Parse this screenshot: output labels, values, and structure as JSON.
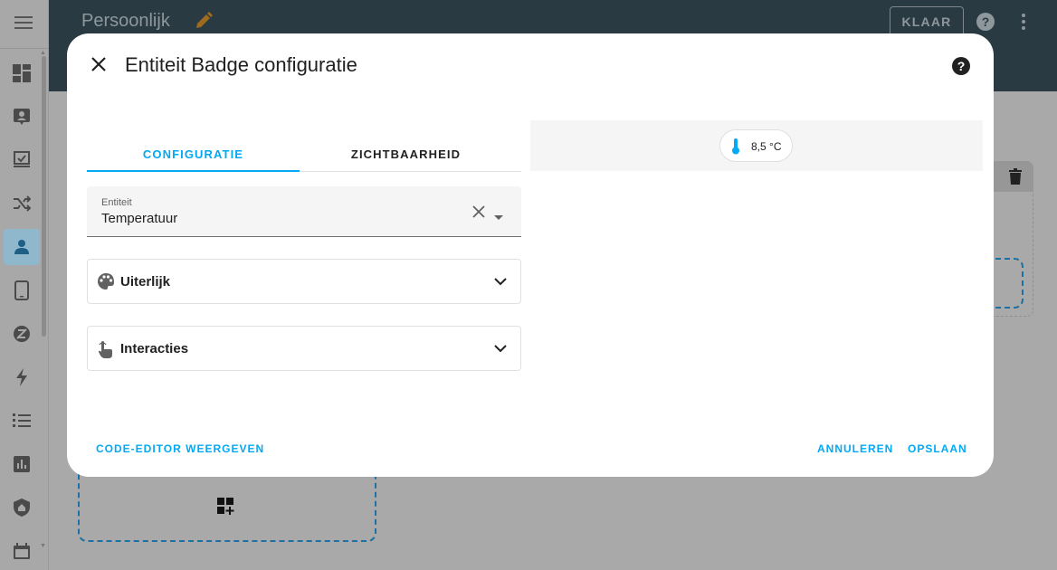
{
  "header": {
    "page_title": "Persoonlijk",
    "done_label": "KLAAR"
  },
  "sidebar": {
    "items": [
      {
        "name": "overview-icon"
      },
      {
        "name": "map-icon"
      },
      {
        "name": "logbook-icon"
      },
      {
        "name": "automations-icon"
      },
      {
        "name": "person-icon",
        "active": true
      },
      {
        "name": "phone-icon"
      },
      {
        "name": "zwave-icon"
      },
      {
        "name": "energy-icon"
      },
      {
        "name": "todo-icon"
      },
      {
        "name": "history-icon"
      },
      {
        "name": "security-icon"
      },
      {
        "name": "calendar-icon"
      }
    ]
  },
  "dialog": {
    "title": "Entiteit Badge configuratie",
    "tabs": [
      {
        "label": "CONFIGURATIE",
        "active": true
      },
      {
        "label": "ZICHTBAARHEID",
        "active": false
      }
    ],
    "entity_field": {
      "label": "Entiteit",
      "value": "Temperatuur"
    },
    "sections": [
      {
        "label": "Uiterlijk",
        "icon": "palette-icon"
      },
      {
        "label": "Interacties",
        "icon": "gesture-tap-icon"
      }
    ],
    "preview": {
      "badge_value": "8,5 °C",
      "badge_icon": "thermometer-icon"
    },
    "footer": {
      "code_editor_label": "CODE-EDITOR WEERGEVEN",
      "cancel_label": "ANNULEREN",
      "save_label": "OPSLAAN"
    }
  },
  "colors": {
    "accent": "#03a9f4",
    "topbar": "#2a3a43",
    "overlay_background": "#a9a9a9"
  }
}
